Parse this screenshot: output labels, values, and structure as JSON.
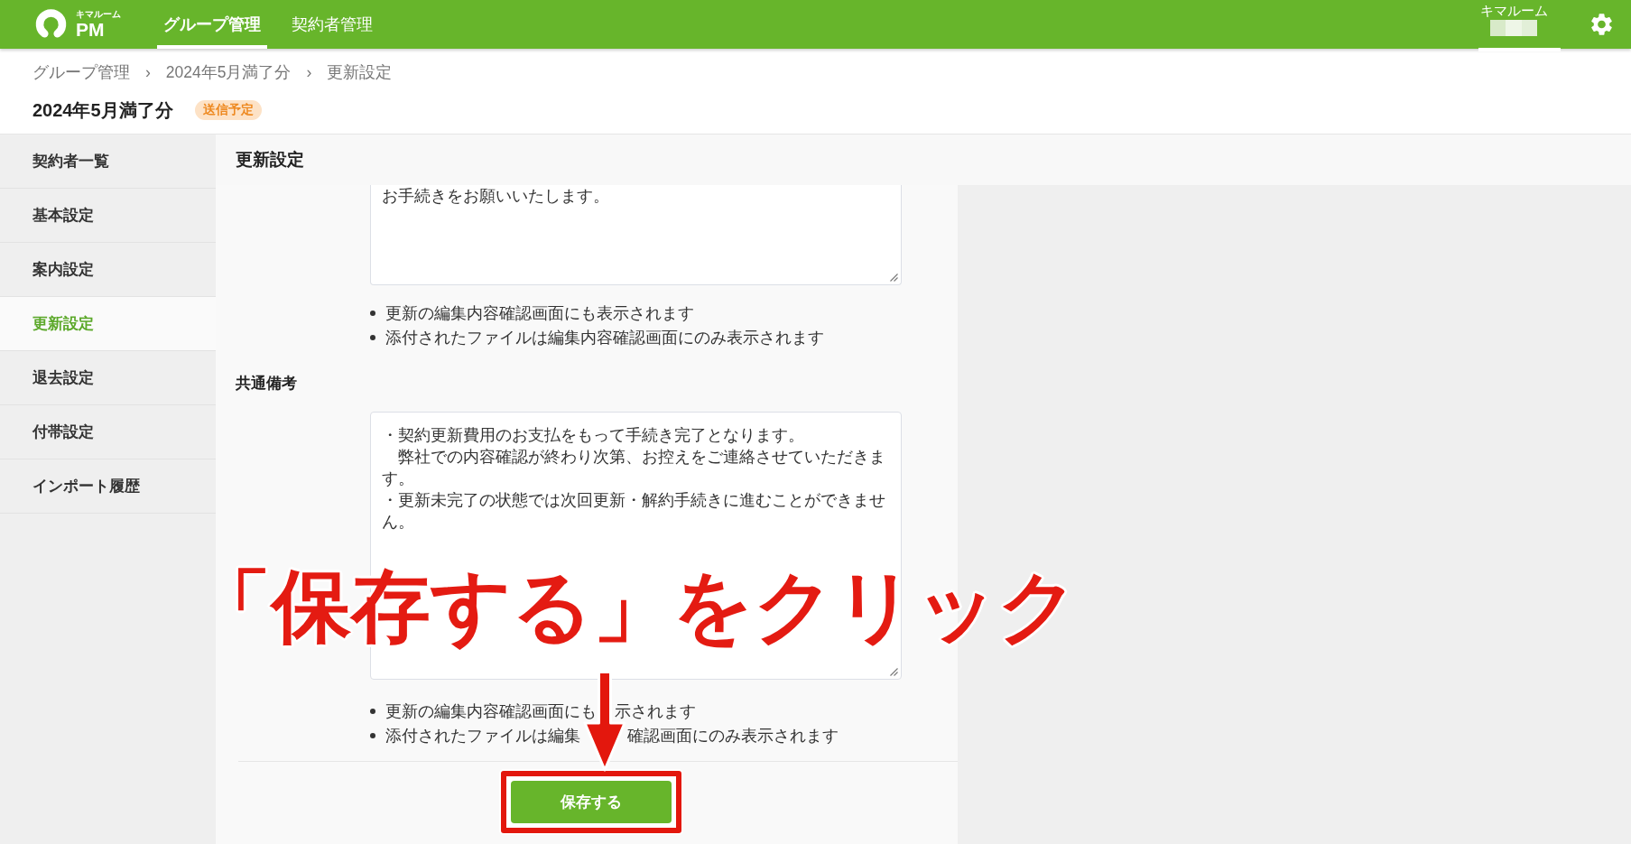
{
  "header": {
    "logo": {
      "caption": "キマルーム",
      "text": "PM"
    },
    "nav": [
      {
        "label": "グループ管理",
        "selected": true
      },
      {
        "label": "契約者管理",
        "selected": false
      }
    ],
    "user": {
      "name": "キマルーム"
    }
  },
  "breadcrumb": [
    {
      "label": "グループ管理",
      "separator": "›"
    },
    {
      "label": "2024年5月満了分",
      "separator": "›"
    },
    {
      "label": "更新設定"
    }
  ],
  "page": {
    "title": "2024年5月満了分",
    "status_badge": "送信予定"
  },
  "sidebar": {
    "items": [
      {
        "label": "契約者一覧",
        "selected": false
      },
      {
        "label": "基本設定",
        "selected": false
      },
      {
        "label": "案内設定",
        "selected": false
      },
      {
        "label": "更新設定",
        "selected": true
      },
      {
        "label": "退去設定",
        "selected": false
      },
      {
        "label": "付帯設定",
        "selected": false
      },
      {
        "label": "インポート履歴",
        "selected": false
      }
    ]
  },
  "settings": {
    "title": "更新設定",
    "fields": [
      {
        "value": [
          "お手続きをお願いいたします。"
        ],
        "notes": [
          [
            "更新の編集内容確認画面にも表示されます"
          ],
          [
            "添付されたファイルは編集内容確認画面にのみ表示されます"
          ]
        ]
      },
      {
        "label": "共通備考",
        "value": [
          "・契約更新費用のお支払をもって手続き完了となります。",
          "　弊社での内容確認が終わり次第、お控えをご連絡させていただきます。",
          "・更新未完了の状態では次回更新・解約手続きに進むことができません。"
        ],
        "notes": [
          [
            "更新の編集内容確認画面にも",
            "示されます"
          ],
          [
            "添付されたファイルは編集",
            "確認画面にのみ表示されます"
          ]
        ]
      }
    ],
    "save_button": "保存する"
  },
  "annotation": {
    "text": "「保存する」をクリック"
  }
}
